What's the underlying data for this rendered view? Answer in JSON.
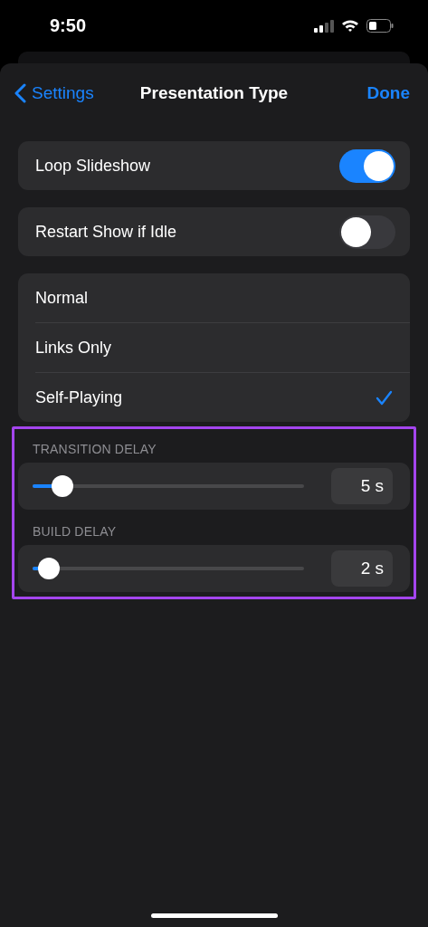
{
  "status_bar": {
    "time": "9:50"
  },
  "nav": {
    "back": "Settings",
    "title": "Presentation Type",
    "done": "Done"
  },
  "toggles": [
    {
      "label": "Loop Slideshow",
      "on": true
    },
    {
      "label": "Restart Show if Idle",
      "on": false
    }
  ],
  "types": [
    {
      "label": "Normal",
      "selected": false
    },
    {
      "label": "Links Only",
      "selected": false
    },
    {
      "label": "Self-Playing",
      "selected": true
    }
  ],
  "delays": [
    {
      "header": "TRANSITION DELAY",
      "level": 0.11,
      "reading": "5 s"
    },
    {
      "header": "BUILD DELAY",
      "level": 0.06,
      "reading": "2 s"
    }
  ]
}
